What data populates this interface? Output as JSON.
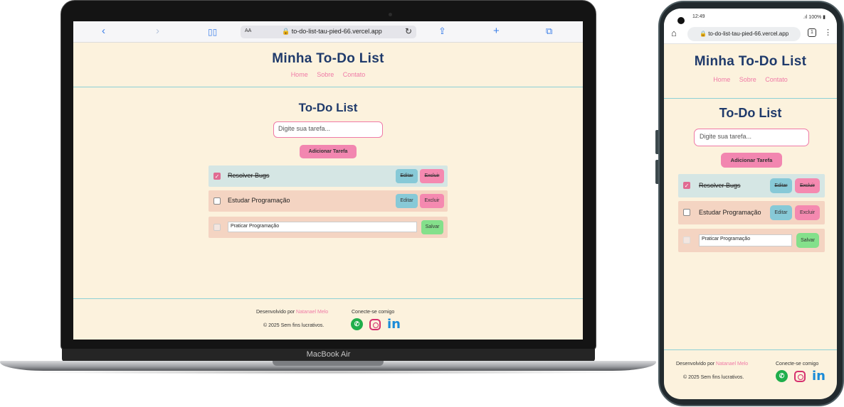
{
  "laptop": {
    "device_label": "MacBook Air",
    "browser": {
      "back_icon": "chevron-left-icon",
      "forward_icon": "chevron-right-icon",
      "reader_label": "AA",
      "url": "to-do-list-tau-pied-66.vercel.app"
    }
  },
  "phone": {
    "status": {
      "time": "12:49",
      "battery": "100%"
    },
    "url": "to-do-list-tau-pied-66.vercel.app",
    "tab_count": "1"
  },
  "site": {
    "title": "Minha To-Do List",
    "nav": [
      "Home",
      "Sobre",
      "Contato"
    ],
    "main_title": "To-Do List",
    "input_placeholder": "Digite sua tarefa...",
    "add_button": "Adicionar Tarefa",
    "tasks": [
      {
        "text": "Resolver Bugs",
        "completed": true,
        "edit_label": "Editar",
        "delete_label": "Excluir",
        "bg": "#d5e6e4"
      },
      {
        "text": "Estudar Programação",
        "completed": false,
        "edit_label": "Editar",
        "delete_label": "Excluir",
        "bg": "#f4d4c2"
      },
      {
        "text": "Praticar Programação",
        "completed": false,
        "editing": true,
        "save_label": "Salvar",
        "bg": "#f4d4c2"
      }
    ],
    "footer": {
      "developed_by": "Desenvolvido por",
      "developer": "Natanael Melo",
      "copyright": "© 2025 Sem fins lucrativos.",
      "connect": "Conecte-se comigo",
      "social_icons": [
        "whatsapp-icon",
        "instagram-icon",
        "linkedin-icon"
      ],
      "linkedin_glyph": "in"
    }
  },
  "colors": {
    "page_bg": "#fcf2dd",
    "title": "#1f3a6b",
    "accent_pink": "#f286b0",
    "edit_blue": "#87c9d7",
    "save_green": "#84e08b",
    "divider": "#8dd0d6"
  }
}
